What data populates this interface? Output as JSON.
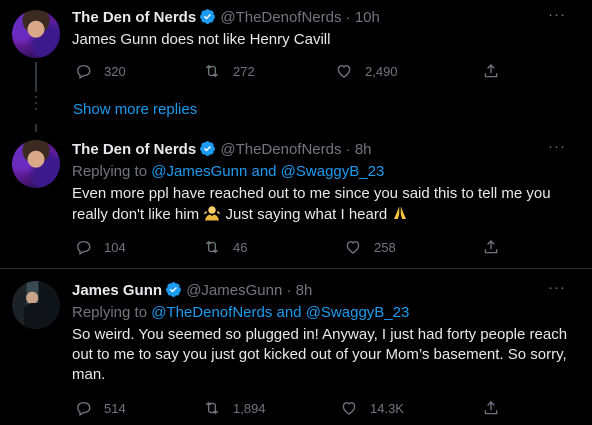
{
  "tweets": [
    {
      "name": "The Den of Nerds",
      "handle": "@TheDenofNerds",
      "sep": "·",
      "time": "10h",
      "replying_prefix": "",
      "replying_to": "",
      "text": "James Gunn does not like Henry Cavill",
      "replies": "320",
      "retweets": "272",
      "likes": "2,490"
    },
    {
      "name": "The Den of Nerds",
      "handle": "@TheDenofNerds",
      "sep": "·",
      "time": "8h",
      "replying_prefix": "Replying to ",
      "replying_to": "@JamesGunn and @SwaggyB_23",
      "text": "Even more ppl have reached out to me since you said this to tell me you really don't like him",
      "text_suffix": "Just saying what I heard",
      "replies": "104",
      "retweets": "46",
      "likes": "258"
    },
    {
      "name": "James Gunn",
      "handle": "@JamesGunn",
      "sep": "·",
      "time": "8h",
      "replying_prefix": "Replying to ",
      "replying_to": "@TheDenofNerds and @SwaggyB_23",
      "text": "So weird. You seemed so plugged in! Anyway, I just had forty people reach out to me to say you just got kicked out of your Mom’s basement. So sorry, man.",
      "replies": "514",
      "retweets": "1,894",
      "likes": "14.3K"
    }
  ],
  "show_more_replies": "Show more replies",
  "more_menu": "···",
  "colors": {
    "accent": "#1d9bf0",
    "muted": "#71767b",
    "text": "#e7e9ea",
    "bg": "#000000"
  },
  "icons": [
    "verified-badge-icon",
    "reply-icon",
    "retweet-icon",
    "like-icon",
    "share-icon",
    "more-icon",
    "person-shrug-emoji",
    "folded-hands-emoji"
  ]
}
